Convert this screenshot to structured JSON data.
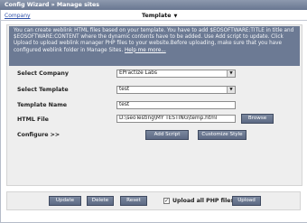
{
  "window": {
    "title": "Config Wizard » Manage sites"
  },
  "header": {
    "company_link": "Company",
    "template_menu": "Template"
  },
  "info": {
    "text": "You can create weblink HTML files based on your template. You have to add $EOSOFTWARE:TITLE in title and $EOSOFTWARE:CONTENT where the dynamic contents have to be added. Use Add script to update. Click Upload to upload weblink manager PHP files to your website.Before uploading, make sure that you have configured weblink folder in Manage Sites.",
    "help_link": "Help me more..."
  },
  "form": {
    "company_label": "Select Company",
    "company_value": "EPractize Labs",
    "template_label": "Select Template",
    "template_value": "test",
    "name_label": "Template Name",
    "name_value": "test",
    "file_label": "HTML File",
    "file_value": "D:\\seoTesting\\MY TESTING\\temp.html",
    "browse_button": "Browse",
    "configure_label": "Configure >>",
    "add_script_button": "Add Script",
    "customize_button": "Customize Style"
  },
  "footer": {
    "update_button": "Update",
    "delete_button": "Delete",
    "reset_button": "Reset",
    "upload_all_label": "Upload all PHP files",
    "upload_all_checked": true,
    "upload_button": "Upload"
  },
  "colors": {
    "titlebar": "#6f7c95",
    "accent": "#5c6983",
    "info_bg": "#6c7a94"
  }
}
